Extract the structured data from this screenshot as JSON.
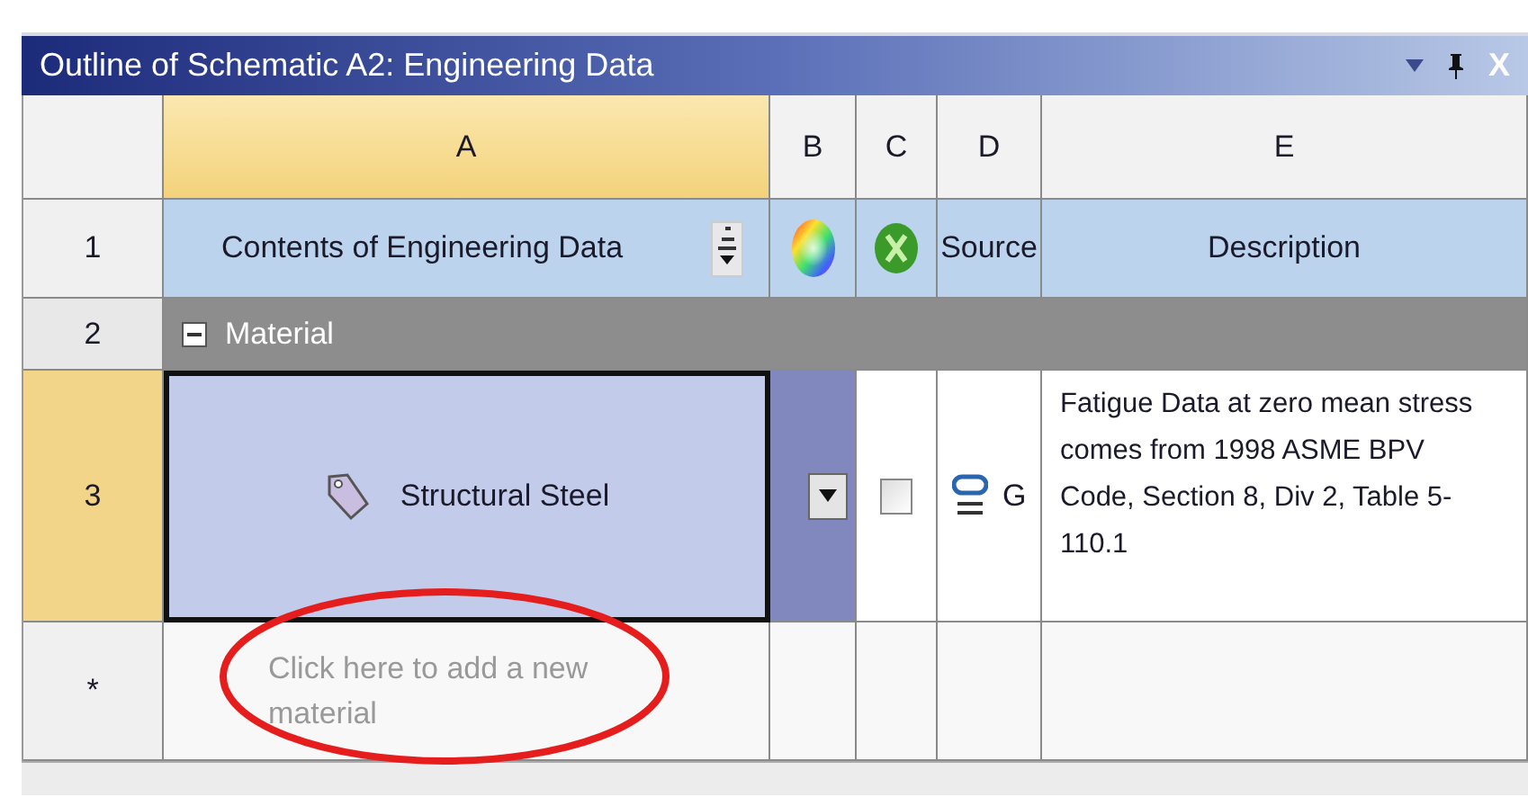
{
  "window": {
    "title": "Outline of Schematic A2: Engineering Data",
    "close_label": "X"
  },
  "columns": [
    {
      "label": "A",
      "selected": true
    },
    {
      "label": "B",
      "selected": false
    },
    {
      "label": "C",
      "selected": false
    },
    {
      "label": "D",
      "selected": false
    },
    {
      "label": "E",
      "selected": false
    }
  ],
  "header_row": {
    "label": "1",
    "contents": "Contents of Engineering Data",
    "source": "Source",
    "description": "Description"
  },
  "group_row": {
    "label": "2",
    "title": "Material",
    "expanded": true
  },
  "materials": [
    {
      "label": "3",
      "name": "Structural Steel",
      "selected": true,
      "suppressed": false,
      "source": "G",
      "description": "Fatigue Data at zero mean stress comes from 1998 ASME BPV Code, Section 8, Div 2, Table 5-110.1"
    }
  ],
  "new_row": {
    "label": "*",
    "placeholder": "Click here to add a new material"
  },
  "annotation": {
    "kind": "ellipse"
  }
}
